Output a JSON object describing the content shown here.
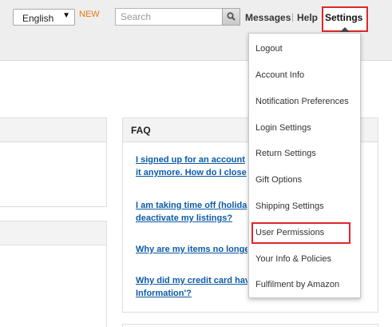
{
  "header": {
    "language": "English",
    "new_badge": "NEW",
    "search_placeholder": "Search",
    "messages": "Messages",
    "separator": "|",
    "help": "Help",
    "settings": "Settings"
  },
  "faq": {
    "title": "FAQ",
    "links": [
      {
        "line1": "I signed up for an account",
        "line2": "it anymore. How do I close"
      },
      {
        "line1": "I am taking time off (holida",
        "line2": "deactivate my listings?"
      },
      {
        "line1": "Why are my items no longe",
        "line2": ""
      },
      {
        "line1": "Why did my credit card hav",
        "line2": "Information'?"
      }
    ]
  },
  "settings_menu": {
    "items": [
      "Logout",
      "Account Info",
      "Notification Preferences",
      "Login Settings",
      "Return Settings",
      "Gift Options",
      "Shipping Settings",
      "User Permissions",
      "Your Info & Policies",
      "Fulfilment by Amazon"
    ],
    "highlighted_item": "User Permissions"
  },
  "colors": {
    "accent_highlight": "#e0262b",
    "link": "#0b5aa8",
    "new_badge": "#e47911",
    "topbar_bg": "#eeeeee"
  }
}
